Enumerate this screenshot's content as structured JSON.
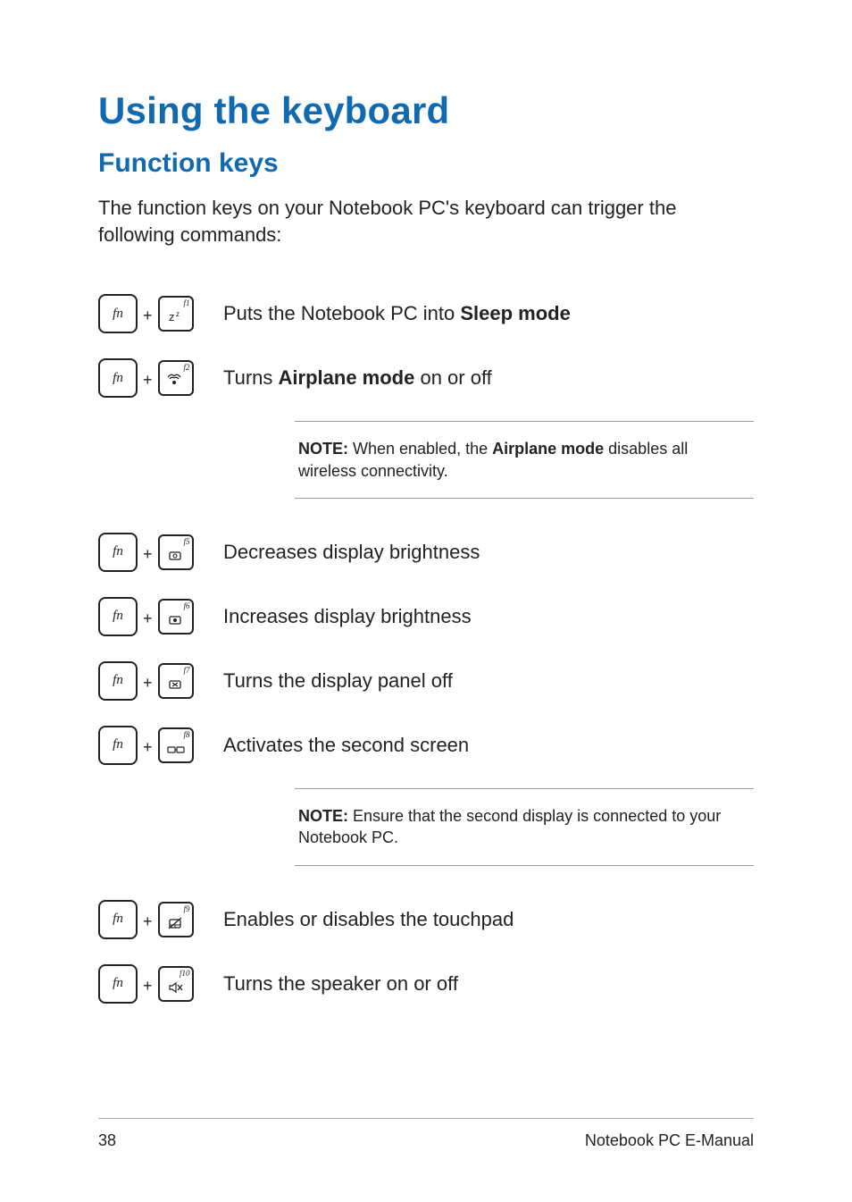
{
  "heading": "Using the keyboard",
  "subheading": "Function keys",
  "intro": "The function keys on your Notebook PC's keyboard can trigger the following commands:",
  "fn_label": "fn",
  "rows": [
    {
      "fkey": "f1",
      "icon": "sleep",
      "desc_pre": "Puts the Notebook PC into ",
      "desc_bold": "Sleep mode",
      "desc_post": ""
    },
    {
      "fkey": "f2",
      "icon": "airplane",
      "desc_pre": "Turns ",
      "desc_bold": "Airplane mode",
      "desc_post": " on or off"
    },
    {
      "fkey": "f5",
      "icon": "bright-dn",
      "desc_pre": "Decreases display brightness",
      "desc_bold": "",
      "desc_post": ""
    },
    {
      "fkey": "f6",
      "icon": "bright-up",
      "desc_pre": "Increases display brightness",
      "desc_bold": "",
      "desc_post": ""
    },
    {
      "fkey": "f7",
      "icon": "display-off",
      "desc_pre": "Turns the display panel off",
      "desc_bold": "",
      "desc_post": ""
    },
    {
      "fkey": "f8",
      "icon": "second-scr",
      "desc_pre": "Activates the second screen",
      "desc_bold": "",
      "desc_post": ""
    },
    {
      "fkey": "f9",
      "icon": "touchpad",
      "desc_pre": "Enables or disables the touchpad",
      "desc_bold": "",
      "desc_post": ""
    },
    {
      "fkey": "f10",
      "icon": "speaker",
      "desc_pre": "Turns the speaker on or off",
      "desc_bold": "",
      "desc_post": ""
    }
  ],
  "notes": {
    "airplane": {
      "label": "NOTE:",
      "pre": " When enabled, the ",
      "bold": "Airplane mode",
      "post": " disables all wireless connectivity."
    },
    "second": {
      "label": "NOTE:",
      "pre": " Ensure that the second display is connected to your Notebook PC.",
      "bold": "",
      "post": ""
    }
  },
  "footer": {
    "page": "38",
    "title": "Notebook PC E-Manual"
  }
}
